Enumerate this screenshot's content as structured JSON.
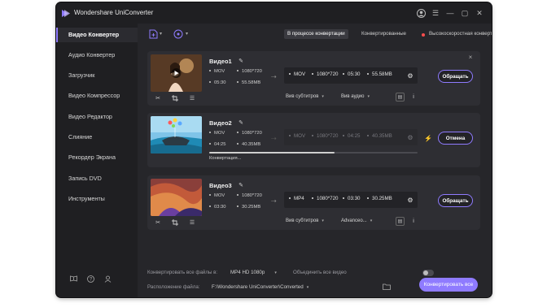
{
  "app": {
    "title": "Wondershare UniConverter",
    "accent": "#8f7bff"
  },
  "sidebar": {
    "items": [
      {
        "label": "Видео Конвертер",
        "active": true
      },
      {
        "label": "Аудио Конвертер"
      },
      {
        "label": "Загрузчик"
      },
      {
        "label": "Видео Компрессор"
      },
      {
        "label": "Видео Редактор"
      },
      {
        "label": "Слияние"
      },
      {
        "label": "Рекордер Экрана"
      },
      {
        "label": "Запись DVD"
      },
      {
        "label": "Инструменты"
      }
    ],
    "bottom_icons": [
      "book-icon",
      "help-icon",
      "account-icon"
    ]
  },
  "toolbar": {
    "tab_converting": "В процессе конвертации",
    "tab_converted": "Конвертированные",
    "high_speed_label": "Высокоскоростная конвертация",
    "high_speed_on": true
  },
  "files": [
    {
      "name": "Видео1",
      "src_format": "MOV",
      "src_res": "1080*720",
      "src_duration": "05:30",
      "src_size": "55.58MB",
      "out_format": "MOV",
      "out_res": "1080*720",
      "out_duration": "05:30",
      "out_size": "55.58MB",
      "subtitle": "Вив субтитров",
      "audio": "Вив аудио",
      "action": "Обращать"
    },
    {
      "name": "Видео2",
      "src_format": "MOV",
      "src_res": "1080*720",
      "src_duration": "04:25",
      "src_size": "40.35MB",
      "out_format": "MOV",
      "out_res": "1080*720",
      "out_duration": "04:25",
      "out_size": "40.35MB",
      "progress_text": "Конвертация...",
      "progress": 0.6,
      "action": "Отмена"
    },
    {
      "name": "Видео3",
      "src_format": "MOV",
      "src_res": "1080*720",
      "src_duration": "03:30",
      "src_size": "30.25MB",
      "out_format": "MP4",
      "out_res": "1080*720",
      "out_duration": "03:30",
      "out_size": "30.25MB",
      "subtitle": "Вив субтитров",
      "audio": "Advanceo...",
      "action": "Обращать"
    }
  ],
  "footer": {
    "convert_all_label": "Конвертировать все файлы в:",
    "convert_all_value": "MP4 HD 1080p",
    "merge_label": "Объединить все видео",
    "output_label": "Расположение файла:",
    "output_path": "F:\\Wondershare UniConverter\\Converted",
    "convert_all_button": "Конвертировать все"
  }
}
